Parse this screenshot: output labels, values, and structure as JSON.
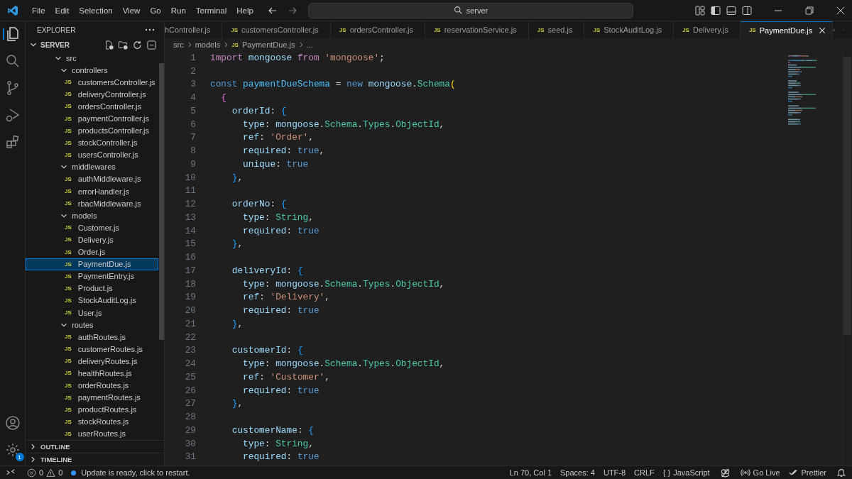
{
  "menu": [
    "File",
    "Edit",
    "Selection",
    "View",
    "Go",
    "Run",
    "Terminal",
    "Help"
  ],
  "search": {
    "value": "server"
  },
  "explorer": {
    "title": "EXPLORER",
    "root": {
      "label": "SERVER",
      "expanded": true,
      "children": [
        {
          "label": "src",
          "expanded": true,
          "children": [
            {
              "label": "controllers",
              "expanded": true,
              "children": [
                {
                  "label": "customersController.js",
                  "icon": "JS",
                  "selected": false
                },
                {
                  "label": "deliveryController.js",
                  "icon": "JS",
                  "selected": false
                },
                {
                  "label": "ordersController.js",
                  "icon": "JS",
                  "selected": false
                },
                {
                  "label": "paymentController.js",
                  "icon": "JS",
                  "selected": false
                },
                {
                  "label": "productsController.js",
                  "icon": "JS",
                  "selected": false
                },
                {
                  "label": "stockController.js",
                  "icon": "JS",
                  "selected": false
                },
                {
                  "label": "usersController.js",
                  "icon": "JS",
                  "selected": false
                }
              ]
            },
            {
              "label": "middlewares",
              "expanded": true,
              "children": [
                {
                  "label": "authMiddleware.js",
                  "icon": "JS",
                  "selected": false
                },
                {
                  "label": "errorHandler.js",
                  "icon": "JS",
                  "selected": false
                },
                {
                  "label": "rbacMiddleware.js",
                  "icon": "JS",
                  "selected": false
                }
              ]
            },
            {
              "label": "models",
              "expanded": true,
              "children": [
                {
                  "label": "Customer.js",
                  "icon": "JS",
                  "selected": false
                },
                {
                  "label": "Delivery.js",
                  "icon": "JS",
                  "selected": false
                },
                {
                  "label": "Order.js",
                  "icon": "JS",
                  "selected": false
                },
                {
                  "label": "PaymentDue.js",
                  "icon": "JS",
                  "selected": true
                },
                {
                  "label": "PaymentEntry.js",
                  "icon": "JS",
                  "selected": false
                },
                {
                  "label": "Product.js",
                  "icon": "JS",
                  "selected": false
                },
                {
                  "label": "StockAuditLog.js",
                  "icon": "JS",
                  "selected": false
                },
                {
                  "label": "User.js",
                  "icon": "JS",
                  "selected": false
                }
              ]
            },
            {
              "label": "routes",
              "expanded": true,
              "children": [
                {
                  "label": "authRoutes.js",
                  "icon": "JS",
                  "selected": false
                },
                {
                  "label": "customerRoutes.js",
                  "icon": "JS",
                  "selected": false
                },
                {
                  "label": "deliveryRoutes.js",
                  "icon": "JS",
                  "selected": false
                },
                {
                  "label": "healthRoutes.js",
                  "icon": "JS",
                  "selected": false
                },
                {
                  "label": "orderRoutes.js",
                  "icon": "JS",
                  "selected": false
                },
                {
                  "label": "paymentRoutes.js",
                  "icon": "JS",
                  "selected": false
                },
                {
                  "label": "productRoutes.js",
                  "icon": "JS",
                  "selected": false
                },
                {
                  "label": "stockRoutes.js",
                  "icon": "JS",
                  "selected": false
                },
                {
                  "label": "userRoutes.js",
                  "icon": "JS",
                  "selected": false
                }
              ]
            }
          ]
        }
      ]
    }
  },
  "sections": [
    {
      "label": "OUTLINE",
      "expanded": false
    },
    {
      "label": "TIMELINE",
      "expanded": false
    }
  ],
  "settings_badge": "1",
  "tabs": [
    {
      "label": "hController.js",
      "selected": false
    },
    {
      "label": "customersController.js",
      "icon": "JS",
      "selected": false
    },
    {
      "label": "ordersController.js",
      "icon": "JS",
      "selected": false
    },
    {
      "label": "reservationService.js",
      "icon": "JS",
      "selected": false
    },
    {
      "label": "seed.js",
      "icon": "JS",
      "selected": false
    },
    {
      "label": "StockAuditLog.js",
      "icon": "JS",
      "selected": false
    },
    {
      "label": "Delivery.js",
      "icon": "JS",
      "selected": false
    },
    {
      "label": "PaymentDue.js",
      "icon": "JS",
      "selected": true
    }
  ],
  "breadcrumbs": [
    {
      "label": "src"
    },
    {
      "label": "models"
    },
    {
      "label": "PaymentDue.js",
      "icon": "JS"
    },
    {
      "label": "..."
    }
  ],
  "code": [
    {
      "n": "1",
      "tokens": [
        {
          "kind": "kw",
          "text": "import "
        },
        {
          "kind": "var",
          "text": "mongoose "
        },
        {
          "kind": "kw",
          "text": "from "
        },
        {
          "kind": "s",
          "text": "'mongoose'"
        },
        {
          "kind": "p",
          "text": ";"
        }
      ]
    },
    {
      "n": "2"
    },
    {
      "n": "3",
      "tokens": [
        {
          "kind": "st",
          "text": "const "
        },
        {
          "kind": "cn",
          "text": "paymentDueSchema"
        },
        {
          "kind": "p",
          "text": " = "
        },
        {
          "kind": "st",
          "text": "new "
        },
        {
          "kind": "var",
          "text": "mongoose"
        },
        {
          "kind": "p",
          "text": "."
        },
        {
          "kind": "cl",
          "text": "Schema"
        },
        {
          "kind": "b1",
          "text": "("
        }
      ]
    },
    {
      "n": "4",
      "tokens": [
        {
          "kind": "b2",
          "text": "  {"
        }
      ]
    },
    {
      "n": "5",
      "tokens": [
        {
          "kind": "var",
          "text": "    orderId"
        },
        {
          "kind": "p",
          "text": ": "
        },
        {
          "kind": "b3",
          "text": "{"
        }
      ]
    },
    {
      "n": "6",
      "tokens": [
        {
          "kind": "var",
          "text": "      type"
        },
        {
          "kind": "p",
          "text": ": "
        },
        {
          "kind": "var",
          "text": "mongoose"
        },
        {
          "kind": "p",
          "text": "."
        },
        {
          "kind": "cl",
          "text": "Schema"
        },
        {
          "kind": "p",
          "text": "."
        },
        {
          "kind": "cl",
          "text": "Types"
        },
        {
          "kind": "p",
          "text": "."
        },
        {
          "kind": "cl",
          "text": "ObjectId"
        },
        {
          "kind": "p",
          "text": ","
        }
      ]
    },
    {
      "n": "7",
      "tokens": [
        {
          "kind": "var",
          "text": "      ref"
        },
        {
          "kind": "p",
          "text": ": "
        },
        {
          "kind": "s",
          "text": "'Order'"
        },
        {
          "kind": "p",
          "text": ","
        }
      ]
    },
    {
      "n": "8",
      "tokens": [
        {
          "kind": "var",
          "text": "      required"
        },
        {
          "kind": "p",
          "text": ": "
        },
        {
          "kind": "st",
          "text": "true"
        },
        {
          "kind": "p",
          "text": ","
        }
      ]
    },
    {
      "n": "9",
      "tokens": [
        {
          "kind": "var",
          "text": "      unique"
        },
        {
          "kind": "p",
          "text": ": "
        },
        {
          "kind": "st",
          "text": "true"
        }
      ]
    },
    {
      "n": "10",
      "tokens": [
        {
          "kind": "b3",
          "text": "    }"
        },
        {
          "kind": "p",
          "text": ","
        }
      ]
    },
    {
      "n": "11"
    },
    {
      "n": "12",
      "tokens": [
        {
          "kind": "var",
          "text": "    orderNo"
        },
        {
          "kind": "p",
          "text": ": "
        },
        {
          "kind": "b3",
          "text": "{"
        }
      ]
    },
    {
      "n": "13",
      "tokens": [
        {
          "kind": "var",
          "text": "      type"
        },
        {
          "kind": "p",
          "text": ": "
        },
        {
          "kind": "cl",
          "text": "String"
        },
        {
          "kind": "p",
          "text": ","
        }
      ]
    },
    {
      "n": "14",
      "tokens": [
        {
          "kind": "var",
          "text": "      required"
        },
        {
          "kind": "p",
          "text": ": "
        },
        {
          "kind": "st",
          "text": "true"
        }
      ]
    },
    {
      "n": "15",
      "tokens": [
        {
          "kind": "b3",
          "text": "    }"
        },
        {
          "kind": "p",
          "text": ","
        }
      ]
    },
    {
      "n": "16"
    },
    {
      "n": "17",
      "tokens": [
        {
          "kind": "var",
          "text": "    deliveryId"
        },
        {
          "kind": "p",
          "text": ": "
        },
        {
          "kind": "b3",
          "text": "{"
        }
      ]
    },
    {
      "n": "18",
      "tokens": [
        {
          "kind": "var",
          "text": "      type"
        },
        {
          "kind": "p",
          "text": ": "
        },
        {
          "kind": "var",
          "text": "mongoose"
        },
        {
          "kind": "p",
          "text": "."
        },
        {
          "kind": "cl",
          "text": "Schema"
        },
        {
          "kind": "p",
          "text": "."
        },
        {
          "kind": "cl",
          "text": "Types"
        },
        {
          "kind": "p",
          "text": "."
        },
        {
          "kind": "cl",
          "text": "ObjectId"
        },
        {
          "kind": "p",
          "text": ","
        }
      ]
    },
    {
      "n": "19",
      "tokens": [
        {
          "kind": "var",
          "text": "      ref"
        },
        {
          "kind": "p",
          "text": ": "
        },
        {
          "kind": "s",
          "text": "'Delivery'"
        },
        {
          "kind": "p",
          "text": ","
        }
      ]
    },
    {
      "n": "20",
      "tokens": [
        {
          "kind": "var",
          "text": "      required"
        },
        {
          "kind": "p",
          "text": ": "
        },
        {
          "kind": "st",
          "text": "true"
        }
      ]
    },
    {
      "n": "21",
      "tokens": [
        {
          "kind": "b3",
          "text": "    }"
        },
        {
          "kind": "p",
          "text": ","
        }
      ]
    },
    {
      "n": "22"
    },
    {
      "n": "23",
      "tokens": [
        {
          "kind": "var",
          "text": "    customerId"
        },
        {
          "kind": "p",
          "text": ": "
        },
        {
          "kind": "b3",
          "text": "{"
        }
      ]
    },
    {
      "n": "24",
      "tokens": [
        {
          "kind": "var",
          "text": "      type"
        },
        {
          "kind": "p",
          "text": ": "
        },
        {
          "kind": "var",
          "text": "mongoose"
        },
        {
          "kind": "p",
          "text": "."
        },
        {
          "kind": "cl",
          "text": "Schema"
        },
        {
          "kind": "p",
          "text": "."
        },
        {
          "kind": "cl",
          "text": "Types"
        },
        {
          "kind": "p",
          "text": "."
        },
        {
          "kind": "cl",
          "text": "ObjectId"
        },
        {
          "kind": "p",
          "text": ","
        }
      ]
    },
    {
      "n": "25",
      "tokens": [
        {
          "kind": "var",
          "text": "      ref"
        },
        {
          "kind": "p",
          "text": ": "
        },
        {
          "kind": "s",
          "text": "'Customer'"
        },
        {
          "kind": "p",
          "text": ","
        }
      ]
    },
    {
      "n": "26",
      "tokens": [
        {
          "kind": "var",
          "text": "      required"
        },
        {
          "kind": "p",
          "text": ": "
        },
        {
          "kind": "st",
          "text": "true"
        }
      ]
    },
    {
      "n": "27",
      "tokens": [
        {
          "kind": "b3",
          "text": "    }"
        },
        {
          "kind": "p",
          "text": ","
        }
      ]
    },
    {
      "n": "28"
    },
    {
      "n": "29",
      "tokens": [
        {
          "kind": "var",
          "text": "    customerName"
        },
        {
          "kind": "p",
          "text": ": "
        },
        {
          "kind": "b3",
          "text": "{"
        }
      ]
    },
    {
      "n": "30",
      "tokens": [
        {
          "kind": "var",
          "text": "      type"
        },
        {
          "kind": "p",
          "text": ": "
        },
        {
          "kind": "cl",
          "text": "String"
        },
        {
          "kind": "p",
          "text": ","
        }
      ]
    },
    {
      "n": "31",
      "tokens": [
        {
          "kind": "var",
          "text": "      required"
        },
        {
          "kind": "p",
          "text": ": "
        },
        {
          "kind": "st",
          "text": "true"
        }
      ]
    }
  ],
  "status": {
    "errors": "0",
    "warnings": "0",
    "update": "Update is ready, click to restart.",
    "position": "Ln 70, Col 1",
    "spaces": "Spaces: 4",
    "encoding": "UTF-8",
    "eol": "CRLF",
    "language_icon": "{ }",
    "language": "JavaScript",
    "live": "Go Live",
    "prettier": "Prettier"
  }
}
